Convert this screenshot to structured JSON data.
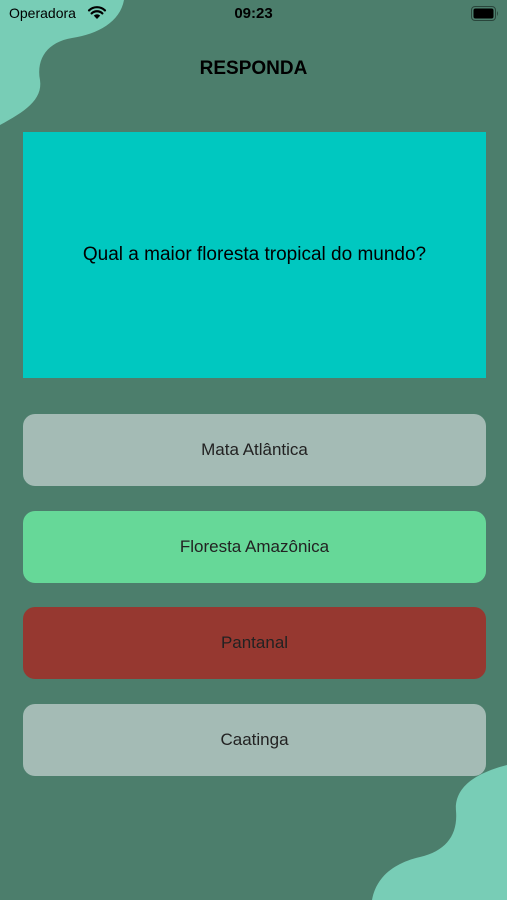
{
  "status_bar": {
    "carrier": "Operadora",
    "time": "09:23",
    "wifi_icon": "wifi-icon",
    "battery_icon": "battery-icon"
  },
  "header": {
    "title": "RESPONDA"
  },
  "question": {
    "text": "Qual a maior floresta tropical do mundo?",
    "background_color": "#00c8c0"
  },
  "answers": [
    {
      "label": "Mata Atlântica",
      "state": "neutral",
      "color": "#a4bbb5"
    },
    {
      "label": "Floresta Amazônica",
      "state": "correct",
      "color": "#66d898"
    },
    {
      "label": "Pantanal",
      "state": "wrong",
      "color": "#963830"
    },
    {
      "label": "Caatinga",
      "state": "neutral",
      "color": "#a4bbb5"
    }
  ],
  "colors": {
    "background": "#4c7e6c",
    "accent_blob": "#78cdb6"
  }
}
